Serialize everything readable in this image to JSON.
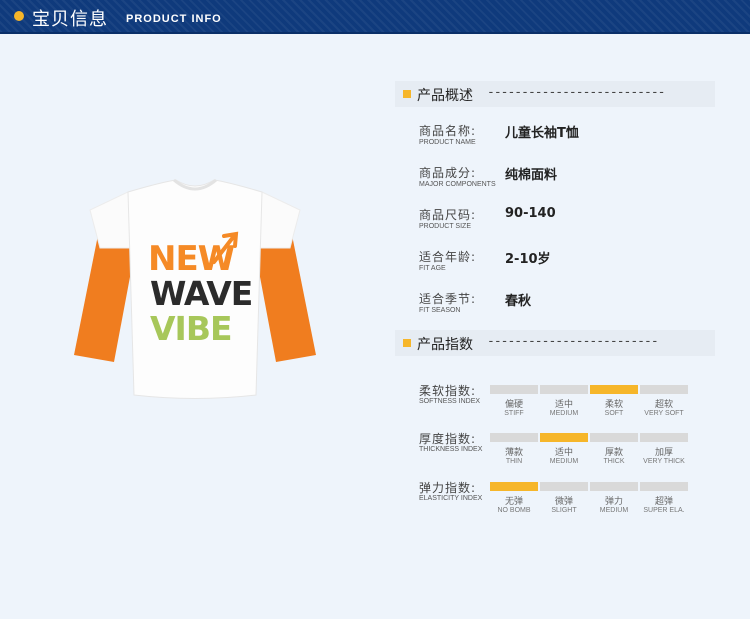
{
  "header": {
    "title_cn": "宝贝信息",
    "title_en": "PRODUCT INFO"
  },
  "colors": {
    "accent": "#f6b62a",
    "header_bg": "#0f3a7c",
    "bar_off": "#d9d9d9"
  },
  "image": {
    "icon": "tshirt-illustration",
    "lines": [
      "NEW",
      "WAVE",
      "VIBE"
    ]
  },
  "overview": {
    "title": "产品概述",
    "dash": "--------------------------",
    "rows": [
      {
        "k_cn": "商品名称:",
        "k_en": "PRODUCT NAME",
        "v": "儿童长袖T恤"
      },
      {
        "k_cn": "商品成分:",
        "k_en": "MAJOR COMPONENTS",
        "v": "纯棉面料"
      },
      {
        "k_cn": "商品尺码:",
        "k_en": "PRODUCT SIZE",
        "v": "90-140"
      },
      {
        "k_cn": "适合年龄:",
        "k_en": "FIT AGE",
        "v": "2-10岁"
      },
      {
        "k_cn": "适合季节:",
        "k_en": "FIT SEASON",
        "v": "春秋"
      }
    ]
  },
  "indices": {
    "title": "产品指数",
    "dash": "-------------------------",
    "rows": [
      {
        "k_cn": "柔软指数:",
        "k_en": "SOFTNESS INDEX",
        "selected": 2,
        "options": [
          {
            "cn": "偏硬",
            "en": "STIFF"
          },
          {
            "cn": "适中",
            "en": "MEDIUM"
          },
          {
            "cn": "柔软",
            "en": "SOFT"
          },
          {
            "cn": "超软",
            "en": "VERY SOFT"
          }
        ]
      },
      {
        "k_cn": "厚度指数:",
        "k_en": "THICKNESS INDEX",
        "selected": 1,
        "options": [
          {
            "cn": "薄款",
            "en": "THIN"
          },
          {
            "cn": "适中",
            "en": "MEDIUM"
          },
          {
            "cn": "厚款",
            "en": "THICK"
          },
          {
            "cn": "加厚",
            "en": "VERY THICK"
          }
        ]
      },
      {
        "k_cn": "弹力指数:",
        "k_en": "ELASTICITY INDEX",
        "selected": 0,
        "options": [
          {
            "cn": "无弹",
            "en": "NO BOMB"
          },
          {
            "cn": "微弹",
            "en": "SLIGHT"
          },
          {
            "cn": "弹力",
            "en": "MEDIUM"
          },
          {
            "cn": "超弹",
            "en": "SUPER ELA."
          }
        ]
      }
    ]
  }
}
